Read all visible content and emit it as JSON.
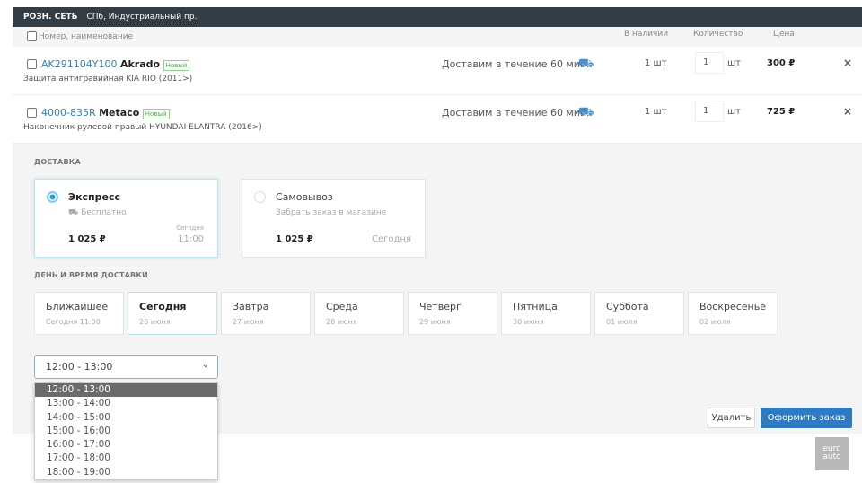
{
  "header": {
    "network": "РОЗН. СЕТЬ",
    "location": "СПб, Индустриальный пр."
  },
  "columns": {
    "name": "Номер, наименование",
    "stock": "В наличии",
    "qty": "Количество",
    "price": "Цена"
  },
  "items": [
    {
      "code": "AK291104Y100",
      "brand": "Akrado",
      "badge": "Новый",
      "desc": "Защита антигравийная KIA RIO (2011>)",
      "delivery": "Доставим в течение 60 мин.",
      "stock": "1 шт",
      "qty": "1",
      "unit": "шт",
      "price": "300 ₽"
    },
    {
      "code": "4000-835R",
      "brand": "Metaco",
      "badge": "Новый",
      "desc": "Наконечник рулевой правый HYUNDAI ELANTRA (2016>)",
      "delivery": "Доставим в течение 60 мин.",
      "stock": "1 шт",
      "qty": "1",
      "unit": "шт",
      "price": "725 ₽"
    }
  ],
  "delivery": {
    "title": "ДОСТАВКА",
    "express": {
      "name": "Экспресс",
      "sub": "Бесплатно",
      "price": "1 025 ₽",
      "when_label": "Сегодня",
      "when_time": "11:00",
      "selected": true
    },
    "pickup": {
      "name": "Самовывоз",
      "sub": "Забрать заказ в магазине",
      "price": "1 025 ₽",
      "when": "Сегодня",
      "selected": false
    }
  },
  "schedule": {
    "title": "ДЕНЬ И ВРЕМЯ ДОСТАВКИ",
    "selected_index": 1,
    "days": [
      {
        "t": "Ближайшее",
        "s": "Сегодня 11:00"
      },
      {
        "t": "Сегодня",
        "s": "26 июня"
      },
      {
        "t": "Завтра",
        "s": "27 июня"
      },
      {
        "t": "Среда",
        "s": "28 июня"
      },
      {
        "t": "Четверг",
        "s": "29 июня"
      },
      {
        "t": "Пятница",
        "s": "30 июня"
      },
      {
        "t": "Суббота",
        "s": "01 июля"
      },
      {
        "t": "Воскресенье",
        "s": "02 июля"
      }
    ]
  },
  "time_select": {
    "value": "12:00 - 13:00",
    "options": [
      "12:00 - 13:00",
      "13:00 - 14:00",
      "14:00 - 15:00",
      "15:00 - 16:00",
      "16:00 - 17:00",
      "17:00 - 18:00",
      "18:00 - 19:00"
    ]
  },
  "actions": {
    "delete": "Удалить",
    "checkout": "Оформить заказ"
  },
  "logo": {
    "line1": "euro",
    "line2": "auto"
  },
  "colors": {
    "accent": "#2f7ac0",
    "header": "#323d46"
  }
}
